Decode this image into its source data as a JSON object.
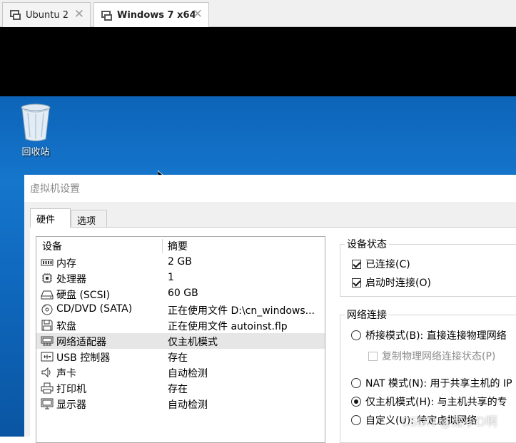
{
  "vm_tabs": [
    {
      "label": "Ubuntu 2",
      "close": "✕"
    },
    {
      "label": "Windows 7 x64",
      "close": "✕"
    }
  ],
  "desktop": {
    "recycle_bin_label": "回收站"
  },
  "dialog": {
    "title": "虚拟机设置",
    "tabs": [
      {
        "label": "硬件"
      },
      {
        "label": "选项"
      }
    ],
    "active_tab": "硬件",
    "device_list": {
      "columns": [
        "设备",
        "摘要"
      ],
      "rows": [
        {
          "name": "内存",
          "summary": "2 GB",
          "icon": "memory-icon"
        },
        {
          "name": "处理器",
          "summary": "1",
          "icon": "cpu-icon"
        },
        {
          "name": "硬盘 (SCSI)",
          "summary": "60 GB",
          "icon": "harddisk-icon"
        },
        {
          "name": "CD/DVD (SATA)",
          "summary": "正在使用文件 D:\\cn_windows...",
          "icon": "cd-dvd-icon"
        },
        {
          "name": "软盘",
          "summary": "正在使用文件 autoinst.flp",
          "icon": "floppy-icon"
        },
        {
          "name": "网络适配器",
          "summary": "仅主机模式",
          "icon": "network-adapter-icon"
        },
        {
          "name": "USB 控制器",
          "summary": "存在",
          "icon": "usb-icon"
        },
        {
          "name": "声卡",
          "summary": "自动检测",
          "icon": "speaker-icon"
        },
        {
          "name": "打印机",
          "summary": "存在",
          "icon": "printer-icon"
        },
        {
          "name": "显示器",
          "summary": "自动检测",
          "icon": "monitor-icon"
        }
      ],
      "selected": "网络适配器"
    },
    "device_status": {
      "title": "设备状态",
      "connected": {
        "label": "已连接(C)",
        "checked": true
      },
      "connect_at_power_on": {
        "label": "启动时连接(O)",
        "checked": true
      }
    },
    "network_connection": {
      "title": "网络连接",
      "options": [
        {
          "label": "桥接模式(B): 直接连接物理网络",
          "selected": false
        },
        {
          "label": "NAT 模式(N): 用于共享主机的 IP",
          "selected": false
        },
        {
          "label": "仅主机模式(H): 与主机共享的专",
          "selected": true
        },
        {
          "label": "自定义(U): 特定虚拟网络",
          "selected": false
        }
      ],
      "replicate_state": {
        "label": "复制物理网络连接状态(P)",
        "checked": false,
        "enabled": false
      }
    }
  },
  "watermark": "CSDN @是小D啊",
  "colors": {
    "desktop_blue": "#1576cc",
    "dialog_bg": "#f0f0f0",
    "selection": "#e6e6e6"
  }
}
